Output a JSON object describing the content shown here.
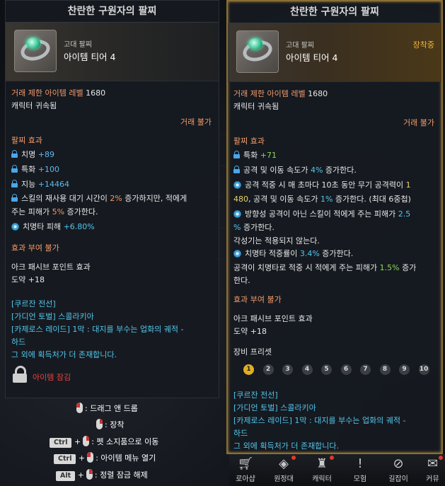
{
  "left_tooltip": {
    "title": "찬란한 구원자의 팔찌",
    "grade": "고대 팔찌",
    "tier": "아이템 티어 4",
    "trade_level": "거래 제한 아이템 레벨",
    "trade_level_value": "1680",
    "bound": "캐릭터 귀속됨",
    "trade_no": "거래 불가",
    "effects_header": "팔찌 효과",
    "stats": [
      {
        "name": "치명",
        "value": "+89"
      },
      {
        "name": "특화",
        "value": "+100"
      },
      {
        "name": "지능",
        "value": "+14464"
      }
    ],
    "skill_cd_a": "스킬의 재사용 대기 시간이 ",
    "skill_cd_pct": "2%",
    "skill_cd_b": " 증가하지만, 적에게",
    "skill_cd_c": "주는 피해가 ",
    "skill_cd_pct2": "5%",
    "skill_cd_d": " 증가한다.",
    "crit_dmg_a": "치명타 피해 ",
    "crit_dmg_b": "+6.80%",
    "no_imbue": "효과 부여 불가",
    "ark_header": "아크 패시브 포인트 효과",
    "ark_value": "도약 +18",
    "sources": [
      "[쿠르잔 전선]",
      "[가디언 토벌] 스콜라키아",
      "[카제로스 레이드] 1막 : 대지를 부수는 업화의 궤적 -",
      "하드",
      "그 외에 획득처가 더 존재합니다."
    ],
    "lock_label": "아이템 잠김"
  },
  "controls": {
    "drag": ": 드래그 앤 드롭",
    "equip": ": 장착",
    "ctrl": "Ctrl",
    "alt": "Alt",
    "plus": "+",
    "pet": ": 펫 소지품으로 이동",
    "menu": ": 아이템 메뉴 열기",
    "sort": ": 정렬 잠금 해제"
  },
  "right_tooltip": {
    "title": "찬란한 구원자의 팔찌",
    "grade": "고대 팔찌",
    "tier": "아이템 티어 4",
    "equipped": "장착중",
    "trade_level": "거래 제한 아이템 레벨",
    "trade_level_value": "1680",
    "bound": "캐릭터 귀속됨",
    "trade_no": "거래 불가",
    "effects_header": "팔찌 효과",
    "stat_name": "특화",
    "stat_value": "+71",
    "speed_a": "공격 및 이동 속도가 ",
    "speed_pct": "4%",
    "speed_b": " 증가한다.",
    "l3a": "공격 적중 시 매 초마다 10초 동안 무기 공격력이 ",
    "l3b": "1",
    "l3c": "480",
    "l3d": ", 공격 및 이동 속도가 ",
    "l3e": "1%",
    "l3f": " 증가한다. (최대 6중첩)",
    "l4a": "방향성 공격이 아닌 스킬이 적에게 주는 피해가 ",
    "l4b": "2.5",
    "l4c": "%",
    "l4d": " 증가한다.",
    "l5": "각성기는 적용되지 않는다.",
    "l6a": "치명타 적중률이 ",
    "l6b": "3.4%",
    "l6c": " 증가한다.",
    "l7a": "공격이 치명타로 적중 시 적에게 주는 피해가 ",
    "l7b": "1.5%",
    "l7c": " 증가",
    "l7d": "한다.",
    "no_imbue": "효과 부여 불가",
    "ark_header": "아크 패시브 포인트 효과",
    "ark_value": "도약 +18",
    "preset_header": "장비 프리셋",
    "presets": [
      "1",
      "2",
      "3",
      "4",
      "5",
      "6",
      "7",
      "8",
      "9",
      "10"
    ],
    "sources": [
      "[쿠르잔 전선]",
      "[가디언 토벌] 스콜라키아",
      "[카제로스 레이드] 1막 : 대지를 부수는 업화의 궤적 -",
      "하드",
      "그 외에 획득처가 더 존재합니다."
    ]
  },
  "bottom_nav": {
    "items": [
      "로아샵",
      "원정대",
      "캐릭터",
      "모험",
      "길잡이",
      "커뮤"
    ]
  },
  "colors": {
    "accent_gold": "#8a6f35",
    "stat_green": "#8cd65a",
    "stat_blue": "#5fb8ee",
    "warn_orange": "#f39a6a"
  }
}
